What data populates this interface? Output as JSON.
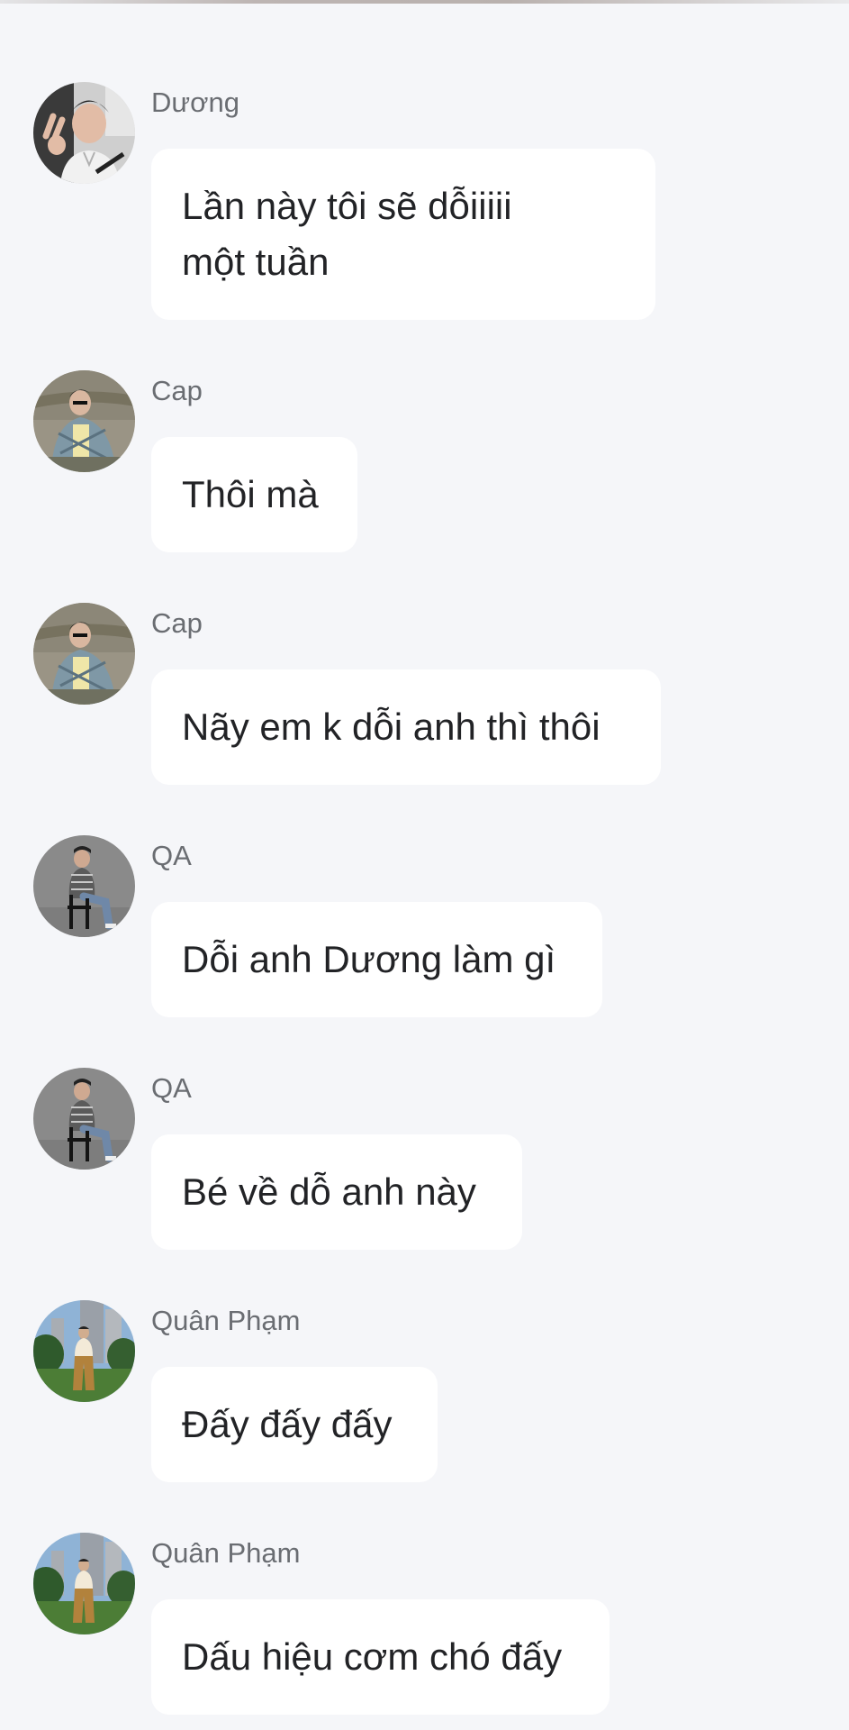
{
  "messages": [
    {
      "sender": "Dương",
      "text": "Lần này tôi sẽ dỗiiiii\nmột tuần",
      "avatar": "avatar-duong"
    },
    {
      "sender": "Cap",
      "text": "Thôi mà",
      "avatar": "avatar-cap"
    },
    {
      "sender": "Cap",
      "text": "Nãy em k dỗi anh thì thôi",
      "avatar": "avatar-cap"
    },
    {
      "sender": "QA",
      "text": "Dỗi anh Dương làm gì",
      "avatar": "avatar-qa"
    },
    {
      "sender": "QA",
      "text": "Bé về dỗ anh này",
      "avatar": "avatar-qa"
    },
    {
      "sender": "Quân Phạm",
      "text": "Đấy đấy đấy",
      "avatar": "avatar-quan-pham"
    },
    {
      "sender": "Quân Phạm",
      "text": "Dấu hiệu cơm chó đấy",
      "avatar": "avatar-quan-pham"
    }
  ],
  "colors": {
    "background": "#f5f6f9",
    "bubble": "#ffffff",
    "sender_text": "#6a6d72",
    "message_text": "#222326"
  }
}
